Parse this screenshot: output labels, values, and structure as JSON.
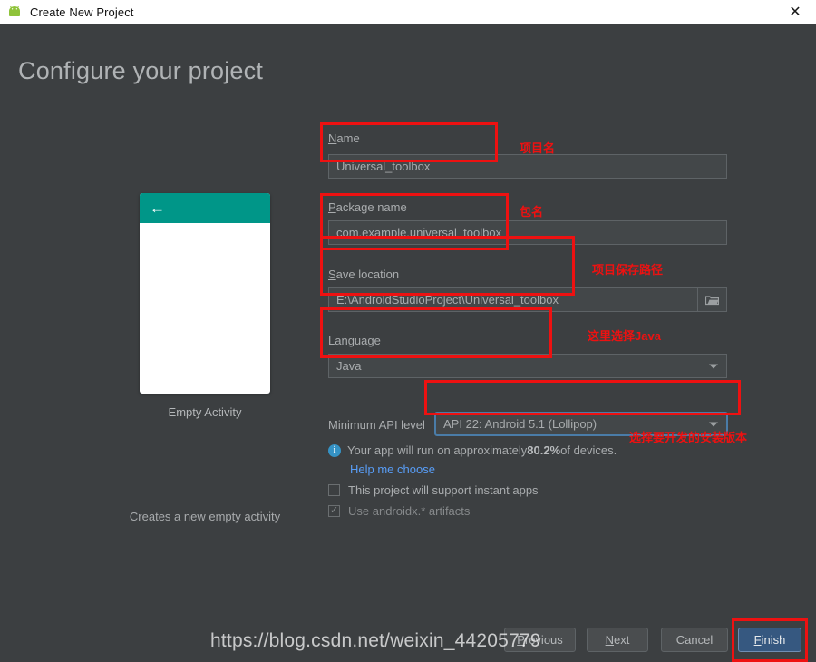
{
  "window": {
    "title": "Create New Project",
    "icon": "android-robot-icon",
    "close_label": "✕"
  },
  "heading": "Configure your project",
  "preview": {
    "back_icon": "←",
    "template_name": "Empty Activity",
    "template_description": "Creates a new empty activity",
    "appbar_color": "#009688"
  },
  "form": {
    "name": {
      "label_mnemonic": "N",
      "label_rest": "ame",
      "value": "Universal_toolbox"
    },
    "package_name": {
      "label_mnemonic": "P",
      "label_rest": "ackage name",
      "value": "com.example.universal_toolbox"
    },
    "save_location": {
      "label_mnemonic": "S",
      "label_rest": "ave location",
      "value": "E:\\AndroidStudioProject\\Universal_toolbox",
      "browse_icon": "folder-icon"
    },
    "language": {
      "label_mnemonic": "L",
      "label_rest": "anguage",
      "value": "Java"
    },
    "min_api": {
      "label": "Minimum API level",
      "value": "API 22: Android 5.1 (Lollipop)"
    },
    "device_info": {
      "icon": "info-icon",
      "prefix": "Your app will run on approximately ",
      "percent": "80.2%",
      "suffix": " of devices.",
      "link": "Help me choose",
      "link_color": "#589df6"
    },
    "checkbox_instant_apps": {
      "label": "This project will support instant apps",
      "checked": false
    },
    "checkbox_androidx": {
      "label": "Use androidx.* artifacts",
      "checked": true,
      "check_glyph": "✓"
    }
  },
  "annotations": {
    "color": "#ee1111",
    "project_name": "项目名",
    "package_name": "包名",
    "save_path": "项目保存路径",
    "language": "这里选择Java",
    "api_level": "选择要开发的安装版本"
  },
  "buttons": {
    "previous_mnemonic": "P",
    "previous_rest": "revious",
    "next_mnemonic": "N",
    "next_rest": "ext",
    "cancel": "Cancel",
    "finish_mnemonic": "F",
    "finish_rest": "inish",
    "finish_color": "#365880"
  },
  "watermark": "https://blog.csdn.net/weixin_44205779"
}
